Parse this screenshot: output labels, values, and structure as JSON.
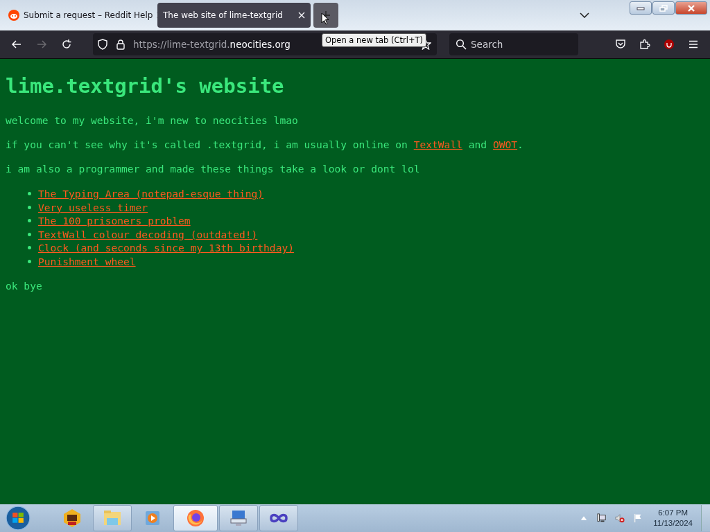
{
  "tabs": [
    {
      "title": "Submit a request – Reddit Help",
      "selected": false
    },
    {
      "title": "The web site of lime-textgrid",
      "selected": true
    }
  ],
  "new_tab_tooltip": "Open a new tab (Ctrl+T)",
  "toolbar": {
    "url_prefix": "https://lime-textgrid.",
    "url_domain": "neocities.org",
    "search_placeholder": "Search",
    "forward_disabled": true
  },
  "page": {
    "heading": "lime.textgrid's website",
    "paragraphs": [
      [
        {
          "text": "welcome to my website, i'm new to neocities lmao",
          "kind": "text"
        }
      ],
      [
        {
          "text": "if you can't see why it's called .textgrid, i am usually online on ",
          "kind": "text"
        },
        {
          "text": "TextWall",
          "kind": "link"
        },
        {
          "text": " and ",
          "kind": "text"
        },
        {
          "text": "OWOT",
          "kind": "link"
        },
        {
          "text": ".",
          "kind": "text"
        }
      ],
      [
        {
          "text": "i am also a programmer and made these things take a look or dont lol",
          "kind": "text"
        }
      ]
    ],
    "links": [
      "The Typing Area (notepad-esque thing)",
      "Very useless timer",
      "The 100 prisoners problem",
      "TextWall colour decoding (outdated!)",
      "Clock (and seconds since my 13th birthday)",
      "Punishment wheel"
    ],
    "closing": "ok bye"
  },
  "taskbar": {
    "apps": [
      {
        "kind": "badge",
        "running": false,
        "selected": false
      },
      {
        "kind": "folder",
        "running": true,
        "selected": false
      },
      {
        "kind": "player",
        "running": false,
        "selected": false
      },
      {
        "kind": "firefox",
        "running": true,
        "selected": true
      },
      {
        "kind": "keyboard",
        "running": true,
        "selected": false
      },
      {
        "kind": "infinity",
        "running": true,
        "selected": false
      }
    ],
    "time": "6:07 PM",
    "date": "11/13/2024"
  }
}
